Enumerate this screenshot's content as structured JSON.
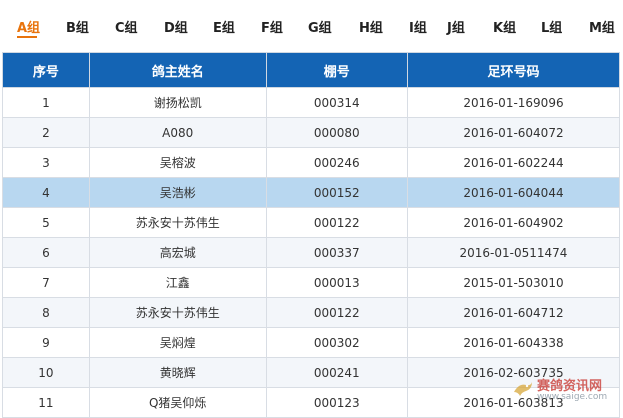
{
  "tabs": [
    {
      "label": "A组",
      "active": true
    },
    {
      "label": "B组",
      "active": false
    },
    {
      "label": "C组",
      "active": false
    },
    {
      "label": "D组",
      "active": false
    },
    {
      "label": "E组",
      "active": false
    },
    {
      "label": "F组",
      "active": false
    },
    {
      "label": "G组",
      "active": false
    },
    {
      "label": "H组",
      "active": false
    },
    {
      "label": "I组",
      "active": false
    },
    {
      "label": "J组",
      "active": false
    },
    {
      "label": "K组",
      "active": false
    },
    {
      "label": "L组",
      "active": false
    },
    {
      "label": "M组",
      "active": false
    }
  ],
  "table": {
    "headers": [
      "序号",
      "鸽主姓名",
      "棚号",
      "足环号码"
    ],
    "rows": [
      [
        "1",
        "谢扬松凯",
        "000314",
        "2016-01-169096"
      ],
      [
        "2",
        "A080",
        "000080",
        "2016-01-604072"
      ],
      [
        "3",
        "吴榕波",
        "000246",
        "2016-01-602244"
      ],
      [
        "4",
        "吴浩彬",
        "000152",
        "2016-01-604044"
      ],
      [
        "5",
        "苏永安十苏伟生",
        "000122",
        "2016-01-604902"
      ],
      [
        "6",
        "高宏城",
        "000337",
        "2016-01-0511474"
      ],
      [
        "7",
        "江鑫",
        "000013",
        "2015-01-503010"
      ],
      [
        "8",
        "苏永安十苏伟生",
        "000122",
        "2016-01-604712"
      ],
      [
        "9",
        "吴焖煌",
        "000302",
        "2016-01-604338"
      ],
      [
        "10",
        "黄晓辉",
        "000241",
        "2016-02-603735"
      ],
      [
        "11",
        "Q猪吴仰烁",
        "000123",
        "2016-01-603813"
      ]
    ],
    "highlighted_row": 3
  },
  "watermark": {
    "brand": "赛鸽资讯网",
    "url": "www.saige.com"
  },
  "colors": {
    "header_bg": "#1464b4",
    "active_tab": "#e8730c",
    "highlight_row": "#b8d7f0",
    "stripe_row": "#f3f6fa"
  }
}
